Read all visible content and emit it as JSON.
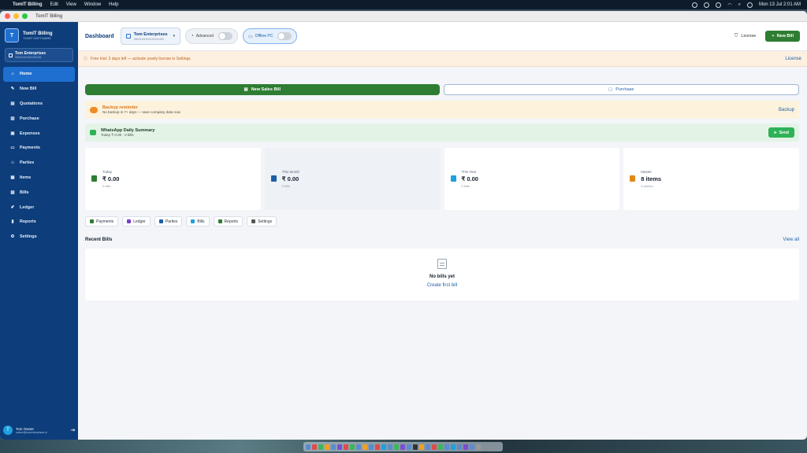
{
  "menubar": {
    "app": "TomIT Billing",
    "items": [
      "Edit",
      "View",
      "Window",
      "Help"
    ],
    "datetime": "Mon 13 Jul  2:01 AM"
  },
  "window": {
    "title": "TomIT Billing"
  },
  "sidebar": {
    "brand_name": "TomIT Billing",
    "brand_sub": "TOMIT SOFTWARE",
    "company_name": "Tom Enterprises",
    "company_id": "33XXXXXXXXXX1Z5",
    "items": [
      {
        "label": "Home",
        "icon": "home-icon"
      },
      {
        "label": "New Bill",
        "icon": "new-bill-icon"
      },
      {
        "label": "Quotations",
        "icon": "quotation-icon"
      },
      {
        "label": "Purchase",
        "icon": "purchase-icon"
      },
      {
        "label": "Expenses",
        "icon": "expenses-icon"
      },
      {
        "label": "Payments",
        "icon": "payments-icon"
      },
      {
        "label": "Parties",
        "icon": "parties-icon"
      },
      {
        "label": "Items",
        "icon": "items-icon"
      },
      {
        "label": "Bills",
        "icon": "bills-icon"
      },
      {
        "label": "Ledger",
        "icon": "ledger-icon"
      },
      {
        "label": "Reports",
        "icon": "reports-icon"
      },
      {
        "label": "Settings",
        "icon": "settings-icon"
      }
    ],
    "user_name": "Tom Owner",
    "user_email": "owner@tomenterprises.in"
  },
  "topbar": {
    "title": "Dashboard",
    "company_name": "Tom Enterprises",
    "company_gstin": "33XXXXXXXXXX1Z5",
    "advanced_label": "Advanced",
    "offline_label": "Offline PC",
    "license_label": "License",
    "new_bill_label": "New Bill"
  },
  "trial": {
    "message": "Free trial: 3 days left — activate yearly license in Settings",
    "link": "License"
  },
  "actions": {
    "new_sales_bill": "New Sales Bill",
    "purchase": "Purchase"
  },
  "backup": {
    "title": "Backup reminder",
    "subtitle": "No backup in 7+ days — save company data now",
    "link": "Backup"
  },
  "whatsapp": {
    "title": "WhatsApp Daily Summary",
    "subtitle": "Today ₹ 0.00 · 0 bills",
    "send_label": "Send"
  },
  "stats": [
    {
      "label": "Today",
      "value": "₹ 0.00",
      "count": "0 bills",
      "color": "#2e7d32"
    },
    {
      "label": "This Month",
      "value": "₹ 0.00",
      "count": "0 bills",
      "color": "#1f5fa8"
    },
    {
      "label": "This Year",
      "value": "₹ 0.00",
      "count": "0 bills",
      "color": "#1fa0e0"
    },
    {
      "label": "Master",
      "value": "8 items",
      "count": "0 parties",
      "color": "#e08a1a"
    }
  ],
  "quick_links": [
    {
      "label": "Payments",
      "color": "#2e7d32"
    },
    {
      "label": "Ledger",
      "color": "#7b3fc4"
    },
    {
      "label": "Parties",
      "color": "#1f5fa8"
    },
    {
      "label": "Bills",
      "color": "#1fa0e0"
    },
    {
      "label": "Reports",
      "color": "#2e7d32"
    },
    {
      "label": "Settings",
      "color": "#555555"
    }
  ],
  "recent": {
    "title": "Recent Bills",
    "view_all": "View all",
    "empty": "No bills yet",
    "create_first": "Create first bill"
  },
  "colors": {
    "sidebar": "#0d3d7a",
    "active": "#1f6fd1",
    "primary_green": "#2e7d32",
    "link_blue": "#1f5fa8"
  }
}
